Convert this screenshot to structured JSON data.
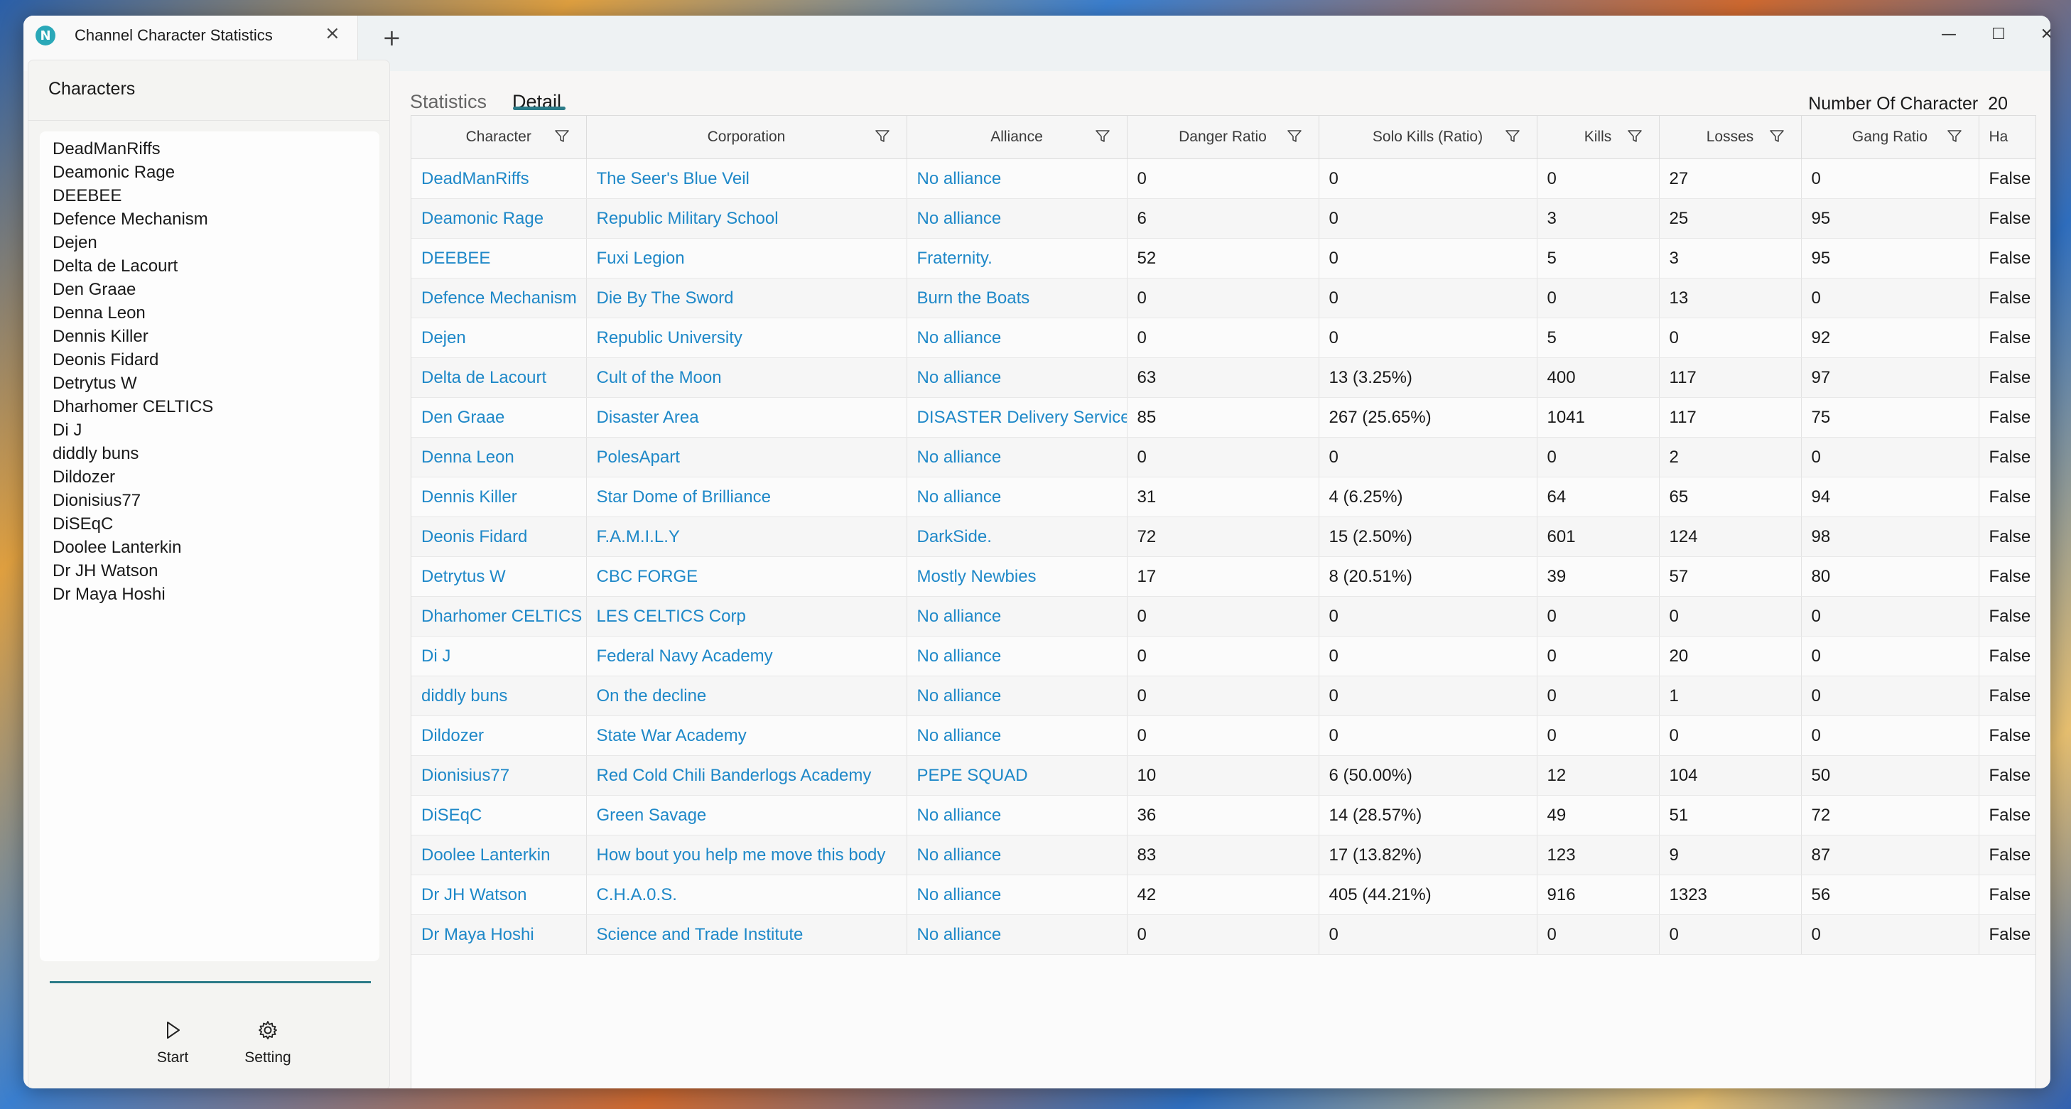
{
  "window": {
    "tab_title": "Channel Character Statistics",
    "app_icon_letter": "N",
    "add_tab_label": "+",
    "minimize": "—",
    "maximize": "☐",
    "close": "✕"
  },
  "left": {
    "header": "Characters",
    "characters": [
      "DeadManRiffs",
      "Deamonic Rage",
      "DEEBEE",
      "Defence Mechanism",
      "Dejen",
      "Delta de Lacourt",
      "Den Graae",
      "Denna Leon",
      "Dennis Killer",
      "Deonis Fidard",
      "Detrytus W",
      "Dharhomer CELTICS",
      "Di J",
      "diddly buns",
      "Dildozer",
      "Dionisius77",
      "DiSEqC",
      "Doolee Lanterkin",
      "Dr JH Watson",
      "Dr Maya Hoshi"
    ],
    "start_label": "Start",
    "setting_label": "Setting"
  },
  "tabs": {
    "statistics": "Statistics",
    "detail": "Detail"
  },
  "count": {
    "label": "Number Of Character",
    "value": "20"
  },
  "table": {
    "columns": [
      "Character",
      "Corporation",
      "Alliance",
      "Danger Ratio",
      "Solo Kills (Ratio)",
      "Kills",
      "Losses",
      "Gang Ratio",
      "Ha"
    ],
    "rows": [
      [
        "DeadManRiffs",
        "The Seer's Blue Veil",
        "No alliance",
        "0",
        "0",
        "0",
        "27",
        "0",
        "False"
      ],
      [
        "Deamonic Rage",
        "Republic Military School",
        "No alliance",
        "6",
        "0",
        "3",
        "25",
        "95",
        "False"
      ],
      [
        "DEEBEE",
        "Fuxi Legion",
        "Fraternity.",
        "52",
        "0",
        "5",
        "3",
        "95",
        "False"
      ],
      [
        "Defence Mechanism",
        "Die By The Sword",
        "Burn the Boats",
        "0",
        "0",
        "0",
        "13",
        "0",
        "False"
      ],
      [
        "Dejen",
        "Republic University",
        "No alliance",
        "0",
        "0",
        "5",
        "0",
        "92",
        "False"
      ],
      [
        "Delta de Lacourt",
        "Cult of the Moon",
        "No alliance",
        "63",
        "13 (3.25%)",
        "400",
        "117",
        "97",
        "False"
      ],
      [
        "Den Graae",
        "Disaster Area",
        "DISASTER Delivery Service",
        "85",
        "267 (25.65%)",
        "1041",
        "117",
        "75",
        "False"
      ],
      [
        "Denna Leon",
        "PolesApart",
        "No alliance",
        "0",
        "0",
        "0",
        "2",
        "0",
        "False"
      ],
      [
        "Dennis Killer",
        "Star Dome of Brilliance",
        "No alliance",
        "31",
        "4 (6.25%)",
        "64",
        "65",
        "94",
        "False"
      ],
      [
        "Deonis Fidard",
        "F.A.M.I.L.Y",
        "DarkSide.",
        "72",
        "15 (2.50%)",
        "601",
        "124",
        "98",
        "False"
      ],
      [
        "Detrytus W",
        "CBC FORGE",
        "Mostly Newbies",
        "17",
        "8 (20.51%)",
        "39",
        "57",
        "80",
        "False"
      ],
      [
        "Dharhomer CELTICS",
        "LES CELTICS Corp",
        "No alliance",
        "0",
        "0",
        "0",
        "0",
        "0",
        "False"
      ],
      [
        "Di J",
        "Federal Navy Academy",
        "No alliance",
        "0",
        "0",
        "0",
        "20",
        "0",
        "False"
      ],
      [
        "diddly buns",
        "On the decline",
        "No alliance",
        "0",
        "0",
        "0",
        "1",
        "0",
        "False"
      ],
      [
        "Dildozer",
        "State War Academy",
        "No alliance",
        "0",
        "0",
        "0",
        "0",
        "0",
        "False"
      ],
      [
        "Dionisius77",
        "Red Cold Chili Banderlogs Academy",
        "PEPE SQUAD",
        "10",
        "6 (50.00%)",
        "12",
        "104",
        "50",
        "False"
      ],
      [
        "DiSEqC",
        "Green Savage",
        "No alliance",
        "36",
        "14 (28.57%)",
        "49",
        "51",
        "72",
        "False"
      ],
      [
        "Doolee Lanterkin",
        "How bout you help me move this body",
        "No alliance",
        "83",
        "17 (13.82%)",
        "123",
        "9",
        "87",
        "False"
      ],
      [
        "Dr JH Watson",
        "C.H.A.0.S.",
        "No alliance",
        "42",
        "405 (44.21%)",
        "916",
        "1323",
        "56",
        "False"
      ],
      [
        "Dr Maya Hoshi",
        "Science and Trade Institute",
        "No alliance",
        "0",
        "0",
        "0",
        "0",
        "0",
        "False"
      ]
    ]
  }
}
